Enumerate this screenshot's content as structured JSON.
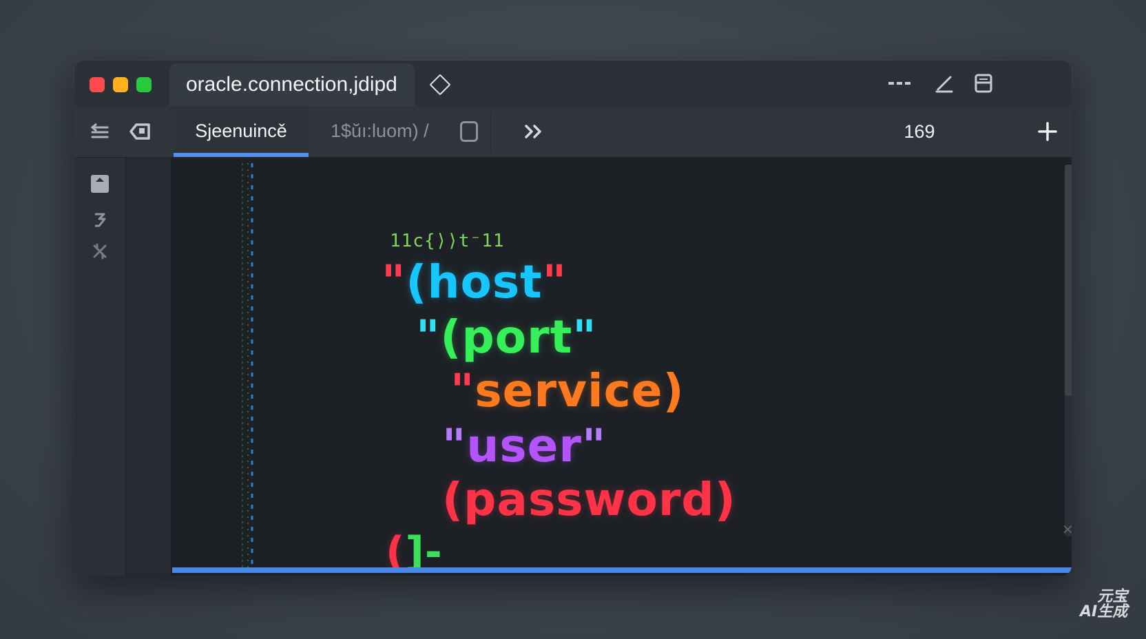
{
  "window": {
    "file_tab": "oracle.connection,jdipd",
    "toolbar": {
      "active_tab": "Sjeenuincě",
      "inactive_tab": "1$ŭı:luom) /",
      "count": "169"
    }
  },
  "code": {
    "first_line": "11c{⟩⟩t⁻11",
    "lines": [
      {
        "quote": "\"",
        "text": "(host",
        "close": "\"",
        "color_quote": "#ff3b4f",
        "color_text": "#18c6ff"
      },
      {
        "quote": "\"",
        "text": "(port",
        "close": "\"",
        "color_quote": "#2fe0f2",
        "color_text": "#36f05a"
      },
      {
        "quote": "\"",
        "text": "service",
        "close": ")",
        "color_quote": "#ff3b4f",
        "color_text": "#ff7a1f"
      },
      {
        "quote": "\"",
        "text": "user",
        "close": "\"",
        "color_quote": "#b57cff",
        "color_text": "#b454ff"
      },
      {
        "quote": "",
        "text": "(password)",
        "close": "",
        "color_quote": "#ff3b4f",
        "color_text": "#ff3347"
      },
      {
        "quote": "",
        "text": "(",
        "close": "",
        "color_quote": "#ff3347",
        "color_text": "#ff3347"
      }
    ],
    "last_fragment_bracket": "]-"
  },
  "colors": {
    "accent": "#4f8ff0",
    "editor_bg": "#1d2126",
    "traffic_red": "#ff4b4b",
    "traffic_yellow": "#ffb21e",
    "traffic_green": "#27c93f"
  },
  "watermark": {
    "line1": "元宝",
    "line2": "AI生成"
  }
}
